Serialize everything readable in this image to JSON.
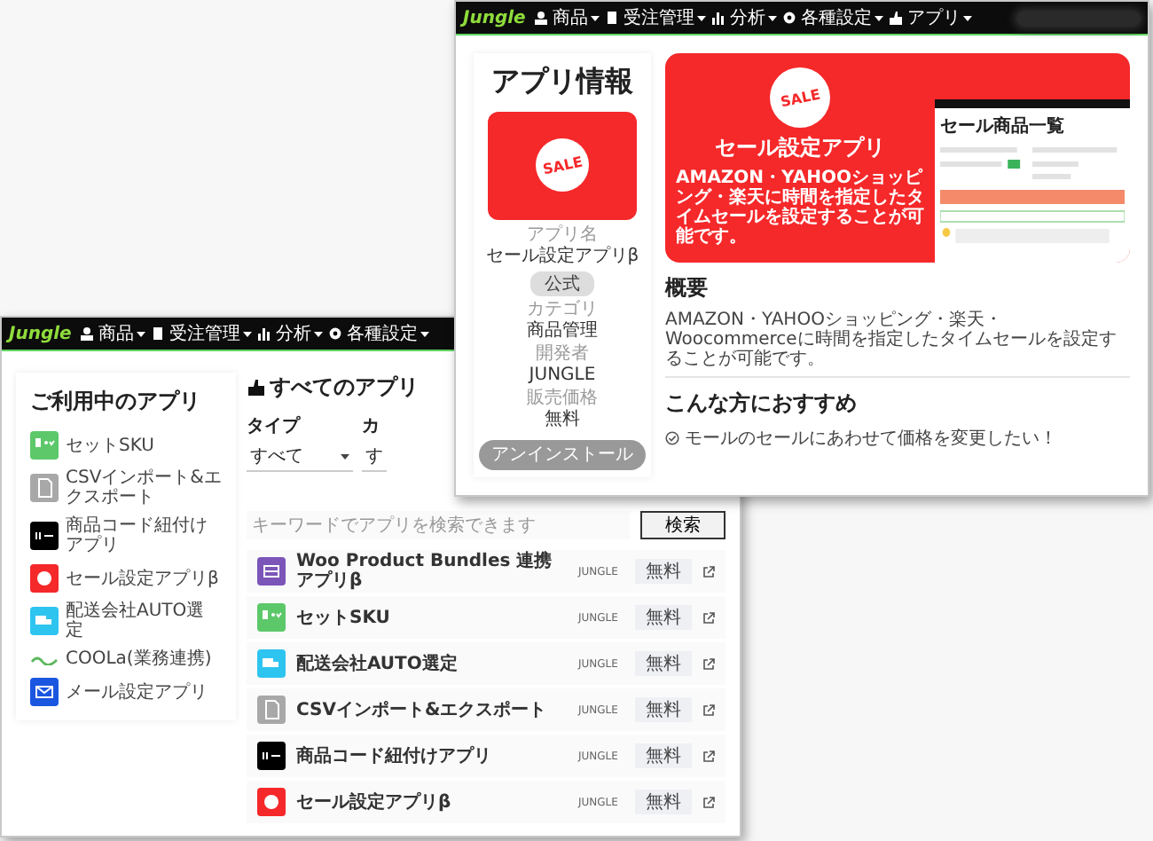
{
  "back_window": {
    "nav": {
      "logo": "Jungle",
      "items": [
        {
          "label": "商品",
          "kind": "person"
        },
        {
          "label": "受注管理",
          "kind": "doc"
        },
        {
          "label": "分析",
          "kind": "chart"
        },
        {
          "label": "各種設定",
          "kind": "gear"
        }
      ]
    },
    "sidebar": {
      "title": "ご利用中のアプリ",
      "items": [
        {
          "label": "セットSKU",
          "kind": "sku",
          "color": "#5cc86a"
        },
        {
          "label": "CSVインポート&エクスポート",
          "kind": "file",
          "color": "#a8a8a8"
        },
        {
          "label": "商品コード紐付けアプリ",
          "kind": "barcode",
          "color": "#000000"
        },
        {
          "label": "セール設定アプリβ",
          "kind": "sale",
          "color": "#f5282a"
        },
        {
          "label": "配送会社AUTO選定",
          "kind": "truck",
          "color": "#2ec4f0"
        },
        {
          "label": "COOLa(業務連携)",
          "kind": "logo"
        },
        {
          "label": "メール設定アプリ",
          "kind": "mail",
          "color": "#1b56e0"
        }
      ]
    },
    "main": {
      "title": "すべてのアプリ",
      "filters": [
        {
          "label": "タイプ",
          "value": "すべて"
        },
        {
          "label": "カ",
          "value": "す"
        }
      ],
      "search": {
        "placeholder": "キーワードでアプリを検索できます",
        "button": "検索"
      },
      "apps": [
        {
          "name": "Woo Product Bundles 連携アプリβ",
          "kind": "bundle",
          "color": "#7b55b8",
          "developer": "JUNGLE",
          "price": "無料"
        },
        {
          "name": "セットSKU",
          "kind": "sku",
          "color": "#5cc86a",
          "developer": "JUNGLE",
          "price": "無料"
        },
        {
          "name": "配送会社AUTO選定",
          "kind": "truck",
          "color": "#2ec4f0",
          "developer": "JUNGLE",
          "price": "無料"
        },
        {
          "name": "CSVインポート&エクスポート",
          "kind": "file",
          "color": "#a8a8a8",
          "developer": "JUNGLE",
          "price": "無料"
        },
        {
          "name": "商品コード紐付けアプリ",
          "kind": "barcode",
          "color": "#000000",
          "developer": "JUNGLE",
          "price": "無料"
        },
        {
          "name": "セール設定アプリβ",
          "kind": "sale",
          "color": "#f5282a",
          "developer": "JUNGLE",
          "price": "無料"
        }
      ]
    }
  },
  "front_window": {
    "nav": {
      "logo": "Jungle",
      "items": [
        {
          "label": "商品",
          "kind": "person"
        },
        {
          "label": "受注管理",
          "kind": "doc"
        },
        {
          "label": "分析",
          "kind": "chart"
        },
        {
          "label": "各種設定",
          "kind": "gear"
        },
        {
          "label": "アプリ",
          "kind": "app"
        }
      ]
    },
    "info": {
      "title": "アプリ情報",
      "sticker": "SALE",
      "name_label": "アプリ名",
      "name": "セール設定アプリβ",
      "badge": "公式",
      "details": [
        {
          "label": "カテゴリ",
          "value": "商品管理"
        },
        {
          "label": "開発者",
          "value": "JUNGLE"
        },
        {
          "label": "販売価格",
          "value": "無料"
        }
      ],
      "button": "アンインストール"
    },
    "banner": {
      "sticker": "SALE",
      "title": "セール設定アプリ",
      "text": "AMAZON・YAHOOショッピング・楽天に時間を指定したタイムセールを設定することが可能です。",
      "screenshot_title": "セール商品一覧"
    },
    "overview": {
      "title": "概要",
      "text": "AMAZON・YAHOOショッピング・楽天・Woocommerceに時間を指定したタイムセールを設定することが可能です。"
    },
    "recommend": {
      "title": "こんな方におすすめ",
      "items": [
        "モールのセールにあわせて価格を変更したい！"
      ]
    }
  }
}
